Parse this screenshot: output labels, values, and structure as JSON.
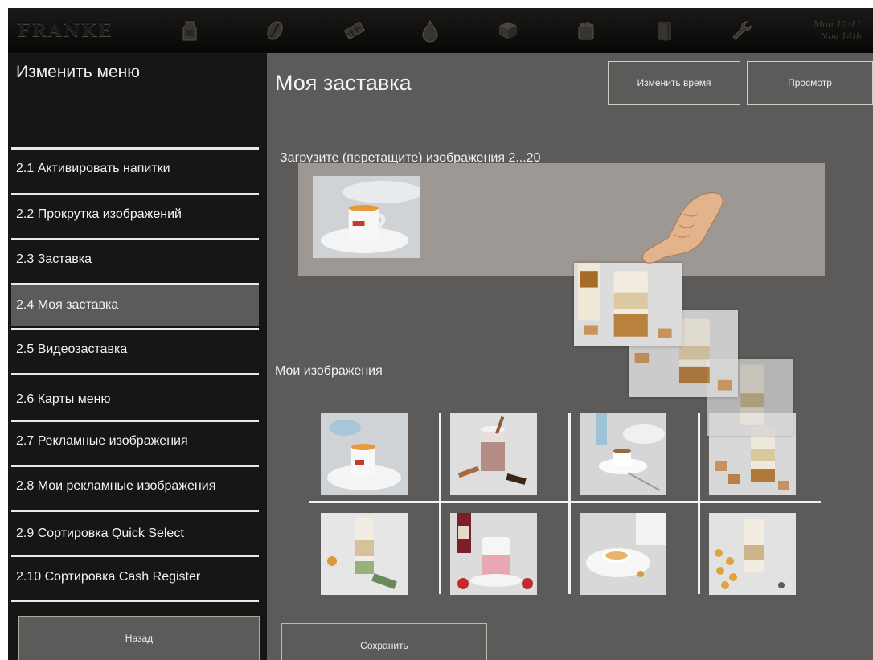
{
  "topbar": {
    "logo": "FRANKE",
    "clock": {
      "line1": "Mon 12:11",
      "line2": "Nov 14th"
    },
    "icons": [
      "milk-carton-icon",
      "coffee-bean-icon",
      "chocolate-bar-icon",
      "water-drop-icon",
      "cup-stack-icon",
      "cleaning-brush-icon",
      "door-icon",
      "wrench-icon"
    ]
  },
  "sidebar": {
    "title": "Изменить меню",
    "items": [
      {
        "label": "2.1 Активировать напитки"
      },
      {
        "label": "2.2 Прокрутка изображений"
      },
      {
        "label": "2.3 Заставка"
      },
      {
        "label": "2.4 Моя заставка",
        "active": true
      },
      {
        "label": "2.5 Видеозаставка"
      },
      {
        "label": "2.6 Карты меню"
      },
      {
        "label": "2.7 Рекламные изображения"
      },
      {
        "label": "2.8 Мои рекламные изображения"
      },
      {
        "label": "2.9 Сортировка Quick Select"
      },
      {
        "label": "2.10 Сортировка Cash Register"
      }
    ],
    "back_label": "Назад"
  },
  "main": {
    "title": "Моя заставка",
    "change_time_label": "Изменить время",
    "preview_label": "Просмотр",
    "upload_label": "Загрузите (перетащите) изображения 2...20",
    "my_images_label": "Мои изображения",
    "save_label": "Сохранить"
  },
  "colors": {
    "sidebar_bg": "#181614",
    "main_bg": "#5c5b59",
    "dropzone_bg": "#9d9894",
    "active_item_bg": "#5c5b59",
    "text": "#f0f0f0"
  }
}
